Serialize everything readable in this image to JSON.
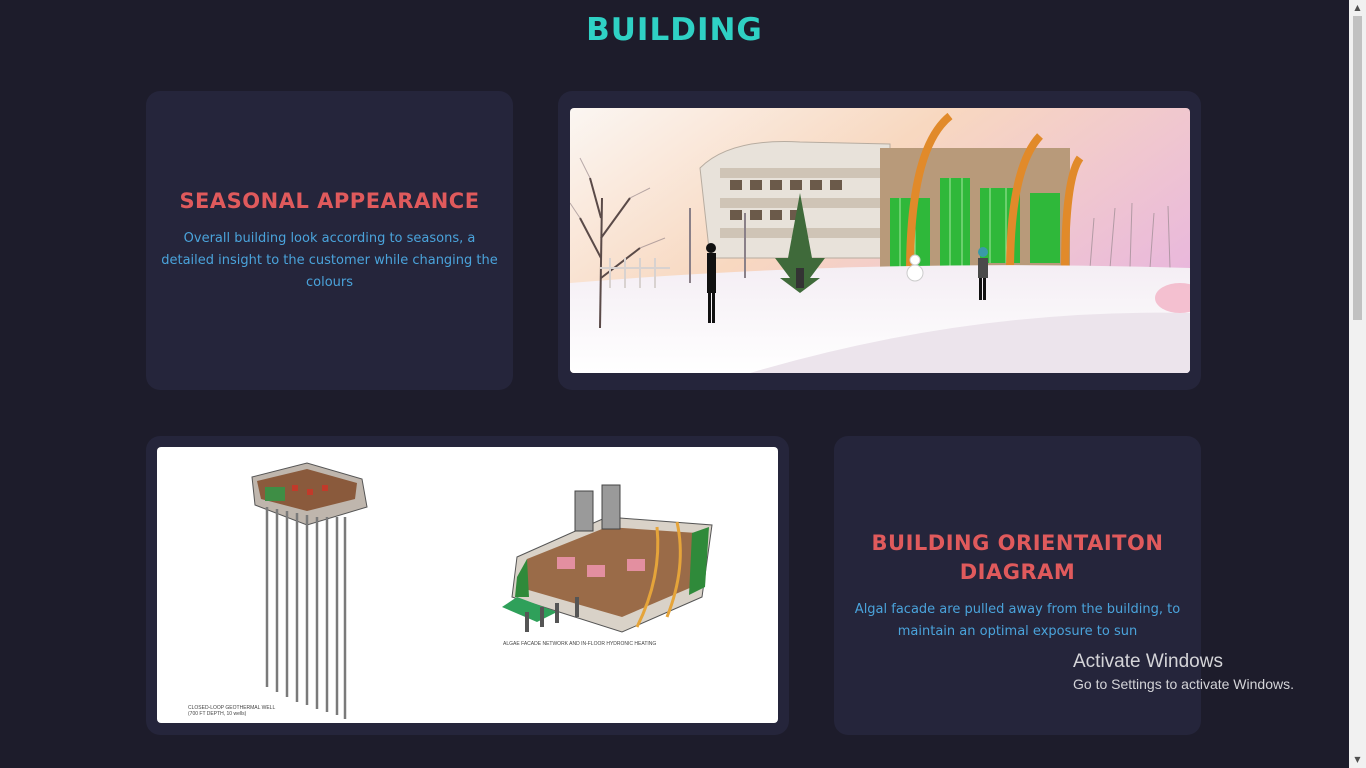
{
  "header": {
    "title": "BUILDING"
  },
  "sections": [
    {
      "heading": "SEASONAL APPEARANCE",
      "description": "Overall building look according to seasons, a detailed insight to the customer while changing the colours"
    },
    {
      "heading": "BUILDING ORIENTAITON DIAGRAM",
      "description": "Algal facade are pulled away from the building, to maintain an optimal exposure to sun"
    }
  ],
  "diagram_captions": {
    "left_line1": "CLOSED-LOOP GEOTHERMAL WELL",
    "left_line2": "(700 FT DEPTH, 10 wells)",
    "right": "ALGAE FACADE NETWORK AND IN-FLOOR HYDRONIC HEATING"
  },
  "os_watermark": {
    "title": "Activate Windows",
    "subtitle": "Go to Settings to activate Windows."
  },
  "colors": {
    "background": "#1d1c2b",
    "card": "#25253b",
    "title": "#2fd1c4",
    "heading": "#e05a5c",
    "body_text": "#4aa3db"
  }
}
